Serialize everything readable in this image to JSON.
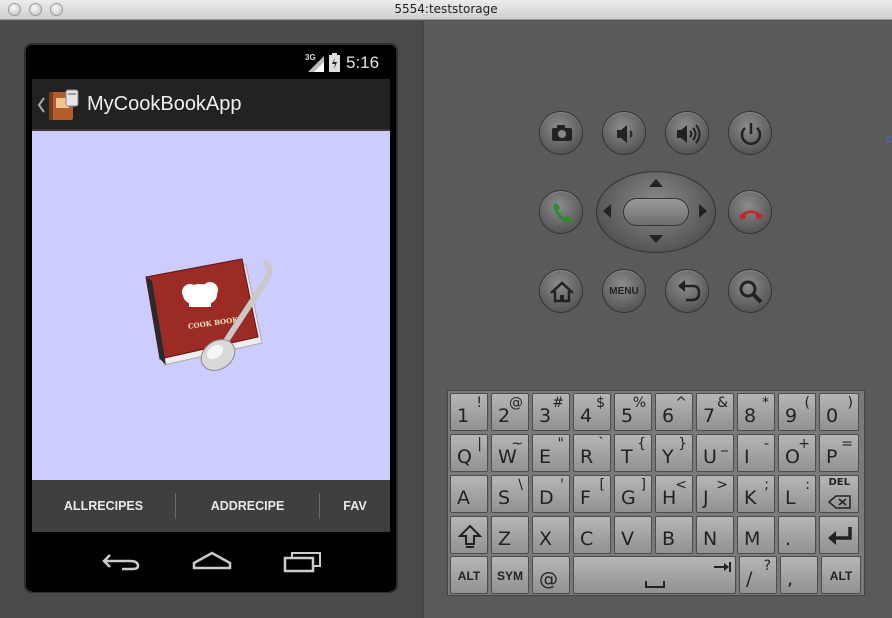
{
  "window": {
    "title": "5554:teststorage"
  },
  "status_bar": {
    "network": "3G",
    "time": "5:16"
  },
  "action_bar": {
    "app_title": "MyCookBookApp"
  },
  "content": {
    "logo_text": "COOK BOOK"
  },
  "tabs": [
    {
      "label": "ALLRECIPES"
    },
    {
      "label": "ADDRECIPE"
    },
    {
      "label": "FAV"
    }
  ],
  "hardware_buttons": {
    "menu_label": "MENU"
  },
  "keyboard": {
    "rows": [
      [
        {
          "main": "1",
          "sub": "!"
        },
        {
          "main": "2",
          "sub": "@"
        },
        {
          "main": "3",
          "sub": "#"
        },
        {
          "main": "4",
          "sub": "$"
        },
        {
          "main": "5",
          "sub": "%"
        },
        {
          "main": "6",
          "sub": "^"
        },
        {
          "main": "7",
          "sub": "&"
        },
        {
          "main": "8",
          "sub": "*"
        },
        {
          "main": "9",
          "sub": "("
        },
        {
          "main": "0",
          "sub": ")"
        }
      ],
      [
        {
          "main": "Q",
          "sub": "|"
        },
        {
          "main": "W",
          "sub": "~"
        },
        {
          "main": "E",
          "sub": "\""
        },
        {
          "main": "R",
          "sub": "`"
        },
        {
          "main": "T",
          "sub": "{"
        },
        {
          "main": "Y",
          "sub": "}"
        },
        {
          "main": "U",
          "sub": "_"
        },
        {
          "main": "I",
          "sub": "-"
        },
        {
          "main": "O",
          "sub": "+"
        },
        {
          "main": "P",
          "sub": "="
        }
      ],
      [
        {
          "main": "A",
          "sub": ""
        },
        {
          "main": "S",
          "sub": "\\"
        },
        {
          "main": "D",
          "sub": "'"
        },
        {
          "main": "F",
          "sub": "["
        },
        {
          "main": "G",
          "sub": "]"
        },
        {
          "main": "H",
          "sub": "<"
        },
        {
          "main": "J",
          "sub": ">"
        },
        {
          "main": "K",
          "sub": ";"
        },
        {
          "main": "L",
          "sub": ":"
        },
        {
          "main": "DEL",
          "sub": ""
        }
      ],
      [
        {
          "main": "",
          "sub": ""
        },
        {
          "main": "Z",
          "sub": ""
        },
        {
          "main": "X",
          "sub": ""
        },
        {
          "main": "C",
          "sub": ""
        },
        {
          "main": "V",
          "sub": ""
        },
        {
          "main": "B",
          "sub": ""
        },
        {
          "main": "N",
          "sub": ""
        },
        {
          "main": "M",
          "sub": ""
        },
        {
          "main": ".",
          "sub": ""
        },
        {
          "main": "",
          "sub": ""
        }
      ]
    ],
    "bottom": {
      "alt_left": "ALT",
      "sym": "SYM",
      "at": "@",
      "slash": "/",
      "question": "?",
      "comma": ",",
      "alt_right": "ALT"
    }
  },
  "colors": {
    "content_bg": "#ccccff",
    "tab_bar": "#3f3f3f",
    "action_bar": "#222222",
    "call_green": "#2e8b2e",
    "end_red": "#c0262b"
  },
  "icons": [
    "chevron-left-icon",
    "app-icon",
    "signal-icon",
    "battery-icon",
    "cookbook-logo",
    "back-icon",
    "home-icon",
    "recents-icon",
    "camera-icon",
    "volume-down-icon",
    "volume-up-icon",
    "power-icon",
    "call-icon",
    "end-call-icon",
    "dpad-up-icon",
    "dpad-down-icon",
    "dpad-left-icon",
    "dpad-right-icon",
    "home-hw-icon",
    "back-hw-icon",
    "search-icon",
    "shift-icon",
    "enter-icon",
    "space-icon",
    "del-icon"
  ]
}
